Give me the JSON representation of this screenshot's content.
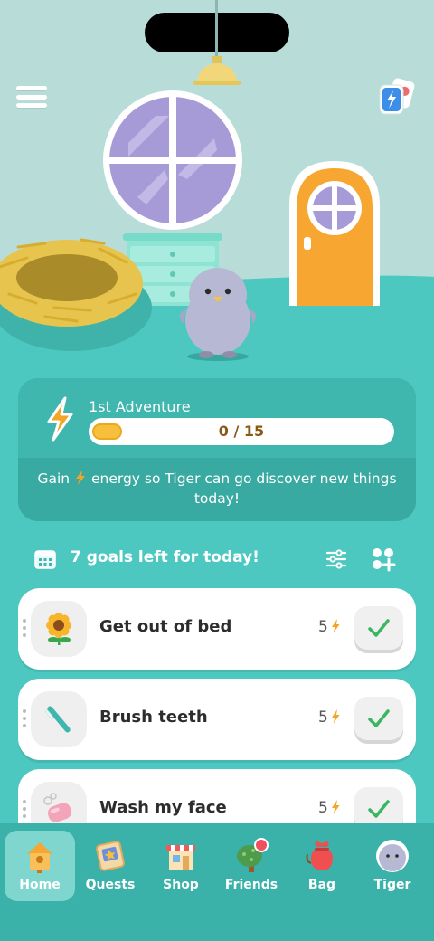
{
  "adventure": {
    "title": "1st Adventure",
    "progress_text": "0 / 15",
    "progress_fraction": 0.1,
    "message_before": "Gain ",
    "message_after": " energy so Tiger can go discover new things today!"
  },
  "goals": {
    "header": "7 goals left for today!",
    "items": [
      {
        "label": "Get out of bed",
        "energy": "5",
        "icon": "sunflower-icon"
      },
      {
        "label": "Brush teeth",
        "energy": "5",
        "icon": "toothbrush-icon"
      },
      {
        "label": "Wash my face",
        "energy": "5",
        "icon": "soap-icon"
      }
    ]
  },
  "nav": {
    "items": [
      {
        "label": "Home",
        "icon": "home-icon",
        "active": true
      },
      {
        "label": "Quests",
        "icon": "quests-icon",
        "active": false
      },
      {
        "label": "Shop",
        "icon": "shop-icon",
        "active": false
      },
      {
        "label": "Friends",
        "icon": "friends-tree-icon",
        "active": false
      },
      {
        "label": "Bag",
        "icon": "bag-icon",
        "active": false
      },
      {
        "label": "Tiger",
        "icon": "tiger-penguin-icon",
        "active": false
      }
    ]
  },
  "colors": {
    "teal": "#4cc8c0",
    "wall": "#b8ddd9",
    "energy_orange": "#f3a526",
    "check_green": "#3cb563",
    "door_orange": "#f7a631",
    "window_purple": "#a69bd6"
  }
}
